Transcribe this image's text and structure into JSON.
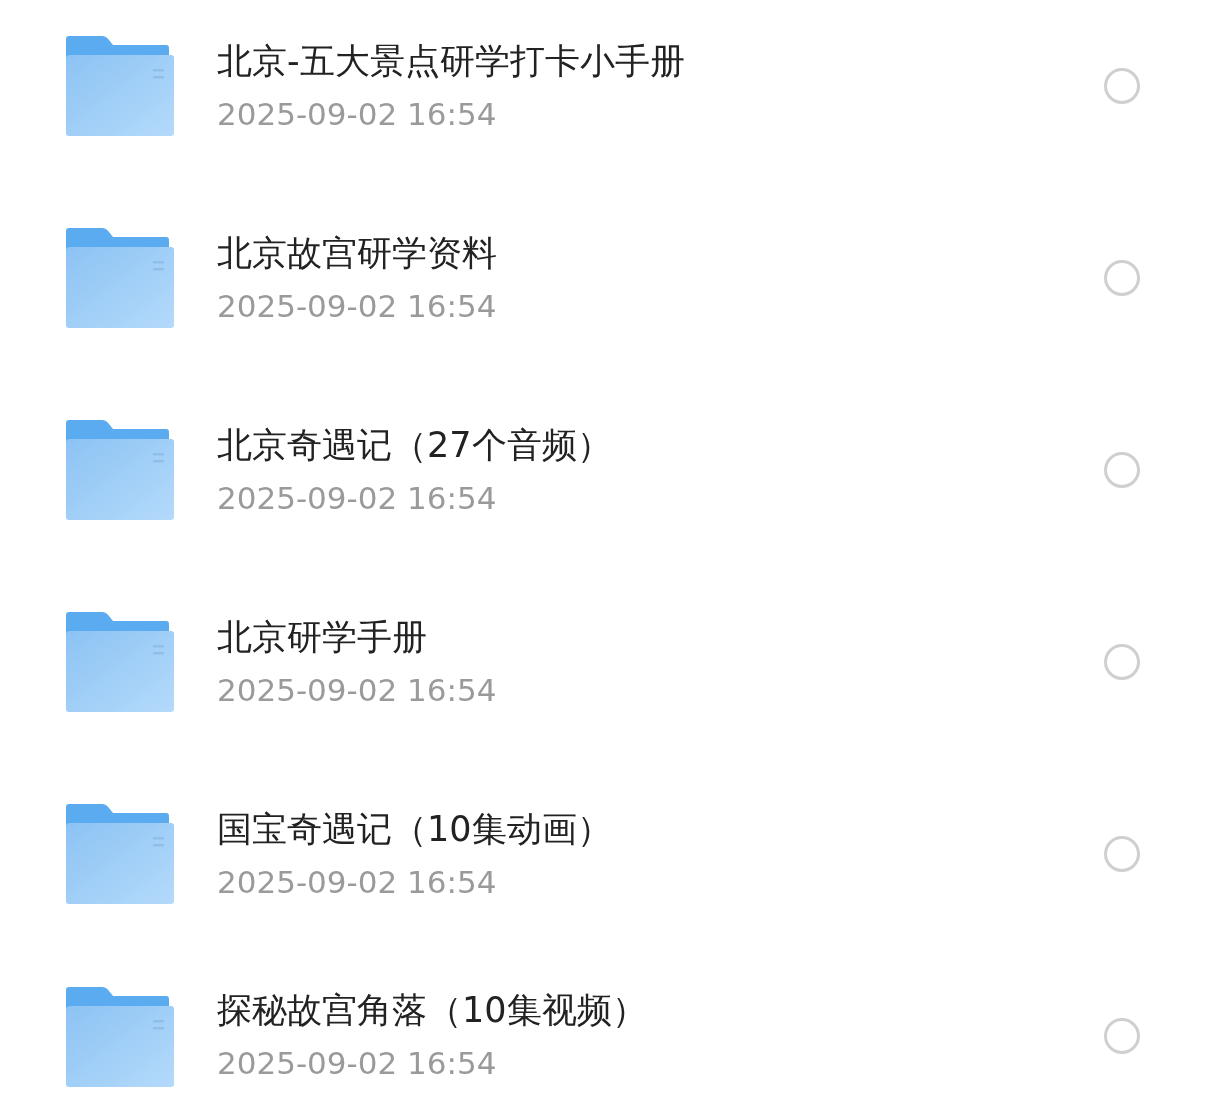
{
  "files": [
    {
      "name": "北京-五大景点研学打卡小手册",
      "date": "2025-09-02 16:54",
      "selected": false
    },
    {
      "name": "北京故宫研学资料",
      "date": "2025-09-02 16:54",
      "selected": false
    },
    {
      "name": "北京奇遇记（27个音频）",
      "date": "2025-09-02 16:54",
      "selected": false
    },
    {
      "name": "北京研学手册",
      "date": "2025-09-02 16:54",
      "selected": false
    },
    {
      "name": "国宝奇遇记（10集动画）",
      "date": "2025-09-02 16:54",
      "selected": false
    },
    {
      "name": "探秘故宫角落（10集视频）",
      "date": "2025-09-02 16:54",
      "selected": false
    }
  ]
}
